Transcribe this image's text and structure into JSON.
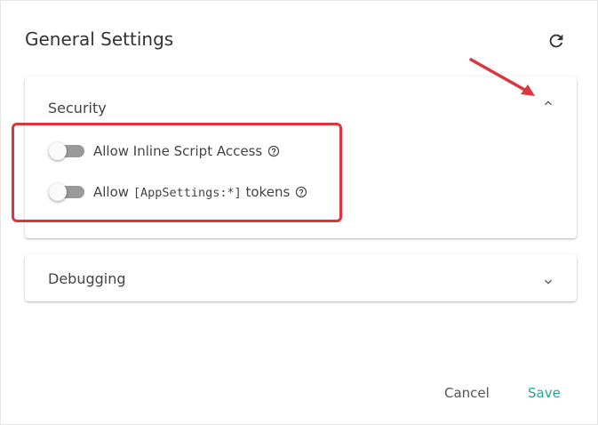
{
  "dialog": {
    "title": "General Settings",
    "refresh_icon": "refresh-icon"
  },
  "sections": [
    {
      "label": "Security",
      "expanded": true,
      "chevron_icon": "chevron-up-icon",
      "settings": [
        {
          "label_prefix": "Allow Inline Script Access",
          "code": "",
          "label_suffix": "",
          "enabled": false,
          "help_icon": "help-circle-icon"
        },
        {
          "label_prefix": "Allow ",
          "code": "[AppSettings:*]",
          "label_suffix": " tokens",
          "enabled": false,
          "help_icon": "help-circle-icon"
        }
      ]
    },
    {
      "label": "Debugging",
      "expanded": false,
      "chevron_icon": "chevron-down-icon"
    }
  ],
  "footer": {
    "cancel_label": "Cancel",
    "save_label": "Save"
  },
  "colors": {
    "accent": "#26a69a",
    "annotation": "#d9363e",
    "switch_track": "#9a9a9a"
  }
}
